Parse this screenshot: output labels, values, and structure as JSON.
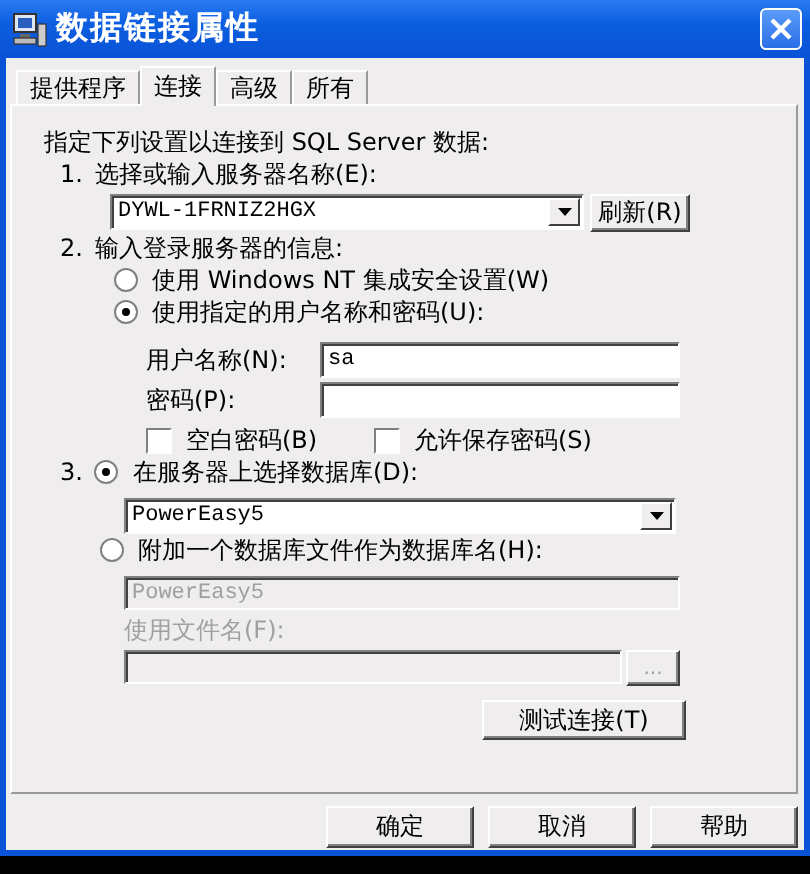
{
  "window": {
    "title": "数据链接属性"
  },
  "tabs": [
    {
      "label": "提供程序",
      "selected": false
    },
    {
      "label": "连接",
      "selected": true
    },
    {
      "label": "高级",
      "selected": false
    },
    {
      "label": "所有",
      "selected": false
    }
  ],
  "intro": "指定下列设置以连接到 SQL Server 数据:",
  "step1": {
    "number": "1.",
    "label": "选择或输入服务器名称(E):",
    "server": {
      "value": "DYWL-1FRNIZ2HGX"
    },
    "refresh_button": "刷新(R)"
  },
  "step2": {
    "number": "2.",
    "label": "输入登录服务器的信息:",
    "options": [
      {
        "label": "使用 Windows NT 集成安全设置(W)",
        "selected": false
      },
      {
        "label": "使用指定的用户名称和密码(U):",
        "selected": true
      }
    ],
    "username": {
      "label": "用户名称(N):",
      "value": "sa"
    },
    "password": {
      "label": "密码(P):"
    },
    "checkboxes": [
      {
        "label": "空白密码(B)",
        "checked": false
      },
      {
        "label": "允许保存密码(S)",
        "checked": false
      }
    ]
  },
  "step3": {
    "number": "3.",
    "options": [
      {
        "label": "在服务器上选择数据库(D):",
        "selected": true
      },
      {
        "label": "附加一个数据库文件作为数据库名(H):",
        "selected": false
      }
    ],
    "database": {
      "value": "PowerEasy5"
    },
    "attach_name": {
      "value": "PowerEasy5",
      "disabled": true
    },
    "file_label": {
      "text": "使用文件名(F):",
      "disabled": true
    },
    "file_field": {
      "disabled": true
    },
    "browse_button": {
      "label": "...",
      "disabled": true
    },
    "test_button": "测试连接(T)"
  },
  "buttons": [
    "确定",
    "取消",
    "帮助"
  ]
}
